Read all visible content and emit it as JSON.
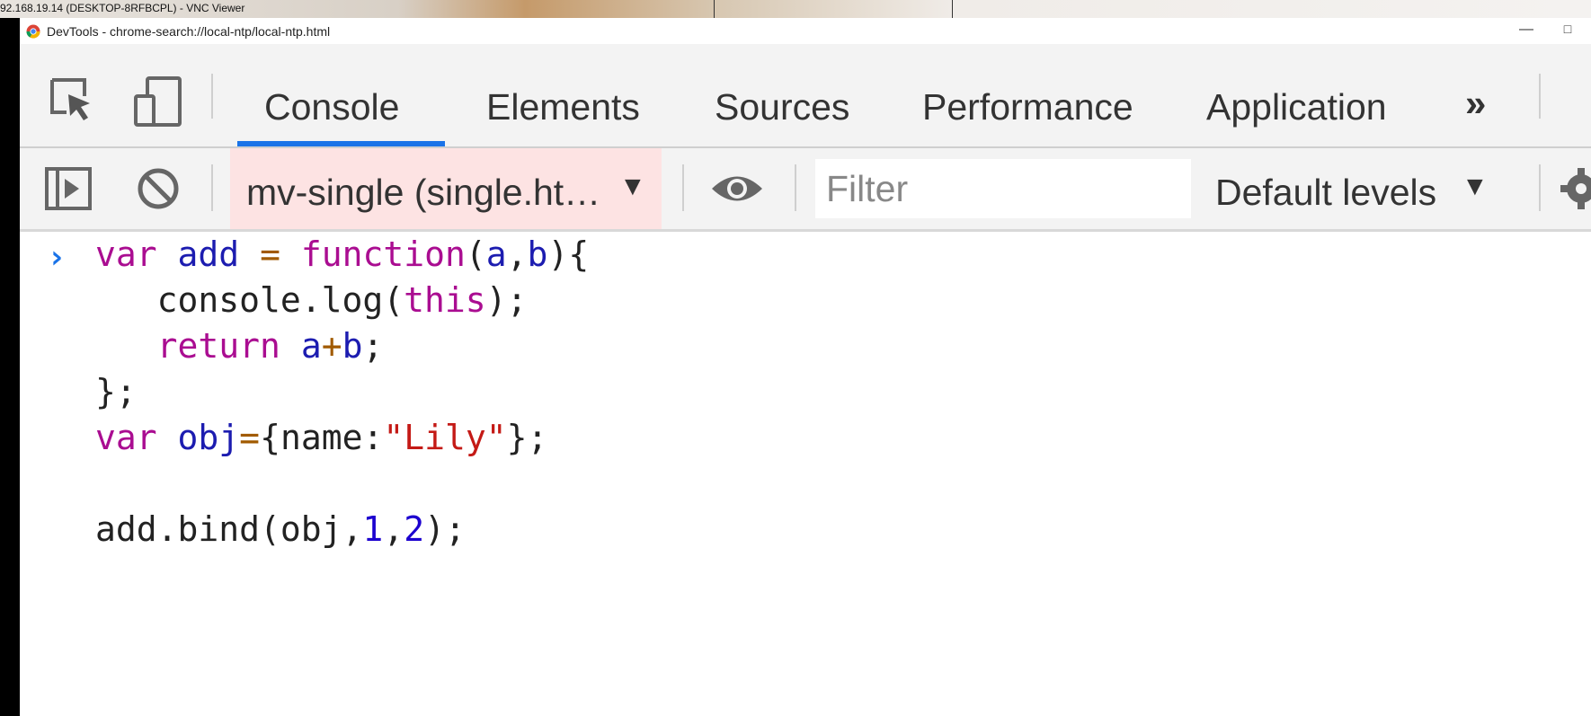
{
  "vnc": {
    "title": "92.168.19.14 (DESKTOP-8RFBCPL) - VNC Viewer"
  },
  "window": {
    "title": "DevTools - chrome-search://local-ntp/local-ntp.html",
    "minimize_glyph": "—",
    "maximize_glyph": "□"
  },
  "tabs": [
    {
      "label": "Console",
      "active": true
    },
    {
      "label": "Elements"
    },
    {
      "label": "Sources"
    },
    {
      "label": "Performance"
    },
    {
      "label": "Application"
    }
  ],
  "more_tabs_glyph": "»",
  "toolbar": {
    "context": "mv-single (single.ht…",
    "context_arrow": "▼",
    "filter_placeholder": "Filter",
    "filter_value": "",
    "levels": "Default levels",
    "levels_arrow": "▼"
  },
  "console": {
    "prompt_glyph": "›",
    "lines": [
      "var add = function(a,b){",
      "   console.log(this);",
      "   return a+b;",
      "};",
      "var obj={name:\"Lily\"};",
      "",
      "add.bind(obj,1,2);"
    ]
  },
  "colors": {
    "accent": "#1a73e8",
    "keyword": "#aa0d91",
    "identifier": "#1c1cb0",
    "string": "#c41a16",
    "number": "#1c00cf",
    "context_bg": "#fde3e3"
  },
  "icons": [
    "inspect-element-icon",
    "device-toolbar-icon",
    "sidebar-toggle-icon",
    "clear-console-icon",
    "eye-icon",
    "gear-icon",
    "chrome-logo-icon"
  ]
}
